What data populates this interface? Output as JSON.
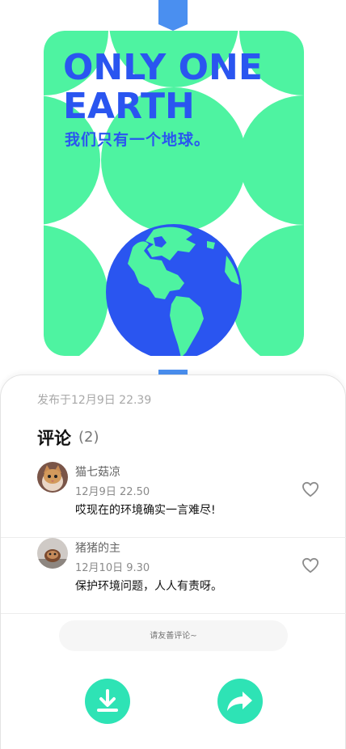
{
  "colors": {
    "poster_green": "#4ef3a1",
    "poster_blue": "#2a55f0",
    "tab_blue": "#4a8ff0",
    "action_teal": "#2ee3b5"
  },
  "poster": {
    "title_line1": "ONLY ONE",
    "title_line2": "EARTH",
    "subtitle": "我们只有一个地球。",
    "image_icon": "earth-globe-icon"
  },
  "post": {
    "publish_time": "发布于12月9日 22.39"
  },
  "comments": {
    "title": "评论",
    "count": "(2)",
    "items": [
      {
        "user": "猫七菇凉",
        "time": "12月9日 22.50",
        "text": "哎现在的环境确实一言难尽!",
        "avatar_icon": "cat-avatar-icon",
        "like_icon": "heart-icon"
      },
      {
        "user": "猪猪的主",
        "time": "12月10日 9.30",
        "text": "保护环境问题，人人有责呀。",
        "avatar_icon": "pet-avatar-icon",
        "like_icon": "heart-icon"
      }
    ]
  },
  "composer": {
    "placeholder": "请友善评论~"
  },
  "actions": {
    "download_icon": "download-icon",
    "share_icon": "share-arrow-icon"
  }
}
